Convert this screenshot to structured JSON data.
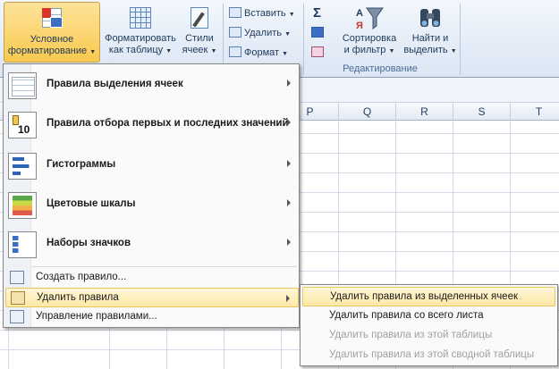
{
  "ribbon": {
    "conditional_formatting": {
      "line1": "Условное",
      "line2": "форматирование"
    },
    "format_as_table": {
      "line1": "Форматировать",
      "line2": "как таблицу"
    },
    "styles": {
      "line1": "Стили",
      "line2": "ячеек"
    },
    "insert": "Вставить",
    "delete": "Удалить",
    "format": "Формат",
    "sigma": "Σ",
    "sort_filter": {
      "line1": "Сортировка",
      "line2": "и фильтр"
    },
    "find_select": {
      "line1": "Найти и",
      "line2": "выделить"
    },
    "group_editing": "Редактирование"
  },
  "columns": [
    "P",
    "Q",
    "R",
    "S",
    "T"
  ],
  "cf_menu": {
    "big_items": [
      {
        "label": "Правила выделения ячеек",
        "icon": "highlight-cells-icon"
      },
      {
        "label": "Правила отбора первых и последних значений",
        "icon": "top-bottom-icon"
      },
      {
        "label": "Гистограммы",
        "icon": "data-bars-icon"
      },
      {
        "label": "Цветовые шкалы",
        "icon": "color-scales-icon"
      },
      {
        "label": "Наборы значков",
        "icon": "icon-sets-icon"
      }
    ],
    "new_rule": "Создать правило...",
    "clear_rules": "Удалить правила",
    "manage_rules": "Управление правилами..."
  },
  "submenu": {
    "items": [
      {
        "label": "Удалить правила из выделенных ячеек",
        "state": "highlighted"
      },
      {
        "label": "Удалить правила со всего листа",
        "state": "enabled"
      },
      {
        "label": "Удалить правила из этой таблицы",
        "state": "disabled"
      },
      {
        "label": "Удалить правила из этой сводной таблицы",
        "state": "disabled"
      }
    ]
  },
  "colors": {
    "highlight": "#fde9a6",
    "ribbon_bg": "#dbe6f4",
    "disabled_text": "#a0a0a0"
  }
}
